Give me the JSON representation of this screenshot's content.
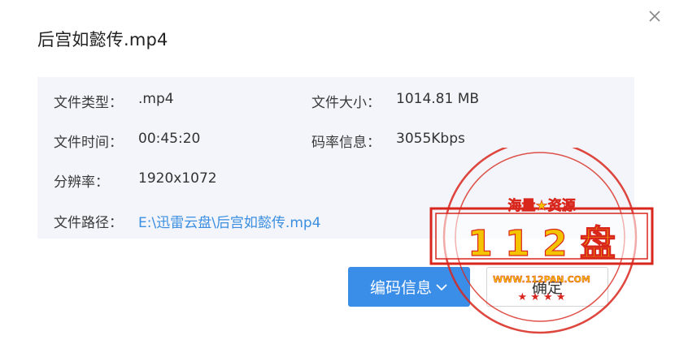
{
  "dialog": {
    "title": "后宫如懿传.mp4",
    "close_icon": "close-icon"
  },
  "info": {
    "type_label": "文件类型：",
    "type_value": ".mp4",
    "size_label": "文件大小：",
    "size_value": "1014.81 MB",
    "duration_label": "文件时间：",
    "duration_value": "00:45:20",
    "bitrate_label": "码率信息：",
    "bitrate_value": "3055Kbps",
    "resolution_label": "分辨率：",
    "resolution_value": "1920x1072",
    "path_label": "文件路径：",
    "path_value": "E:\\迅雷云盘\\后宫如懿传.mp4"
  },
  "buttons": {
    "codec_info": "编码信息",
    "ok": "确定"
  },
  "watermark": {
    "top_text": "海量★资源",
    "main_text": "1 1 2 盘",
    "url": "WWW.112PAN.COM"
  },
  "colors": {
    "primary": "#3b8ee8",
    "panel_bg": "#f3f5fa",
    "path_link": "#3b8ee0",
    "stamp_red": "#d8261c",
    "stamp_yellow": "#f5c400"
  }
}
